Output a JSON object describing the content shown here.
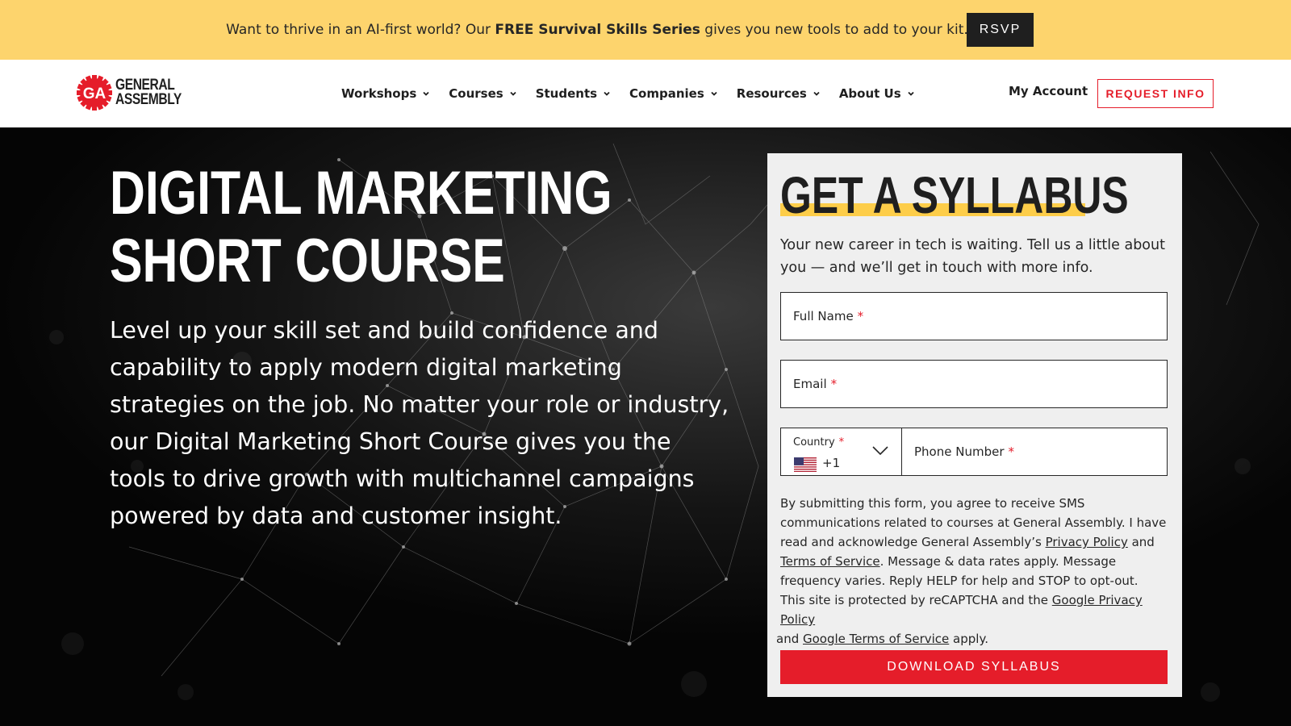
{
  "promo": {
    "text_before": "Want to thrive in an AI-first world? Our ",
    "text_bold": "FREE Survival Skills Series",
    "text_after": " gives you new tools to add to your kit.",
    "rsvp_label": "RSVP"
  },
  "header": {
    "logo_mark": "GA",
    "logo_line1": "GENERAL",
    "logo_line2": "ASSEMBLY",
    "menu": [
      {
        "label": "Workshops"
      },
      {
        "label": "Courses"
      },
      {
        "label": "Students"
      },
      {
        "label": "Companies"
      },
      {
        "label": "Resources"
      },
      {
        "label": "About Us"
      }
    ],
    "account_label": "My Account",
    "request_info_label": "REQUEST INFO"
  },
  "hero": {
    "title_line1": "DIGITAL MARKETING",
    "title_line2": "SHORT COURSE",
    "description": "Level up your skill set and build confidence and capability to apply modern digital marketing strategies on the job. No matter your role or industry, our Digital Marketing Short Course gives you the tools to drive growth with multichannel campaigns powered by data and customer insight."
  },
  "form": {
    "title": "GET A SYLLABUS",
    "intro": "Your new career in tech is waiting. Tell us a little about you — and we’ll get in touch with more info.",
    "full_name_label": "Full Name",
    "email_label": "Email",
    "country_label": "Country",
    "country_code": "+1",
    "phone_label": "Phone Number",
    "required_mark": "*",
    "legal_1": "By submitting this form, you agree to receive SMS communications related to courses at General Assembly. I have read and acknowledge General Assembly’s ",
    "privacy_link": "Privacy Policy",
    "legal_and": " and ",
    "terms_link": "Terms of Service",
    "legal_2": ". Message & data rates apply. Message frequency varies. Reply HELP for help and STOP to opt-out.",
    "recaptcha_1": "This site is protected by reCAPTCHA and the ",
    "google_privacy_link": "Google Privacy Policy",
    "recaptcha_and": " and ",
    "google_terms_link": "Google Terms of Service",
    "recaptcha_2": " apply.",
    "submit_label": "DOWNLOAD SYLLABUS"
  },
  "colors": {
    "promo_bg": "#fdd46d",
    "accent_red": "#e51d2a",
    "highlight_yellow": "#fdcd49",
    "dark": "#1f1f1f"
  },
  "icons": [
    "chevron-down-icon",
    "us-flag-icon",
    "ga-logo-icon"
  ]
}
